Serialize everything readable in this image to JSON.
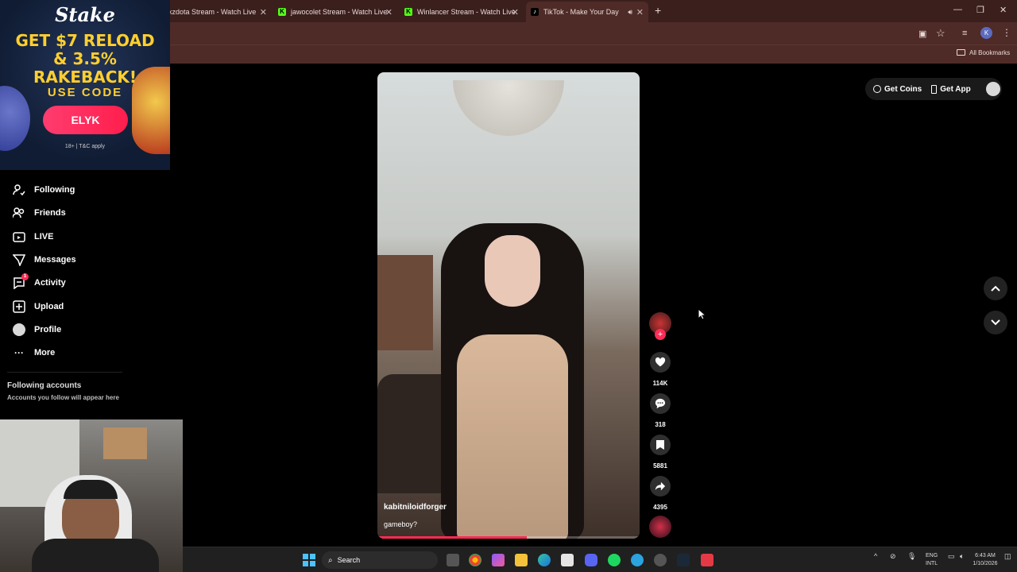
{
  "browser": {
    "tabs": [
      {
        "label": "kzdota Stream - Watch Live",
        "active": false
      },
      {
        "label": "jawocolet Stream - Watch Live",
        "active": false
      },
      {
        "label": "Winlancer Stream - Watch Live",
        "active": false
      },
      {
        "label": "TikTok - Make Your Day",
        "active": true
      }
    ],
    "new_tab": "+",
    "bookmarks_label": "All Bookmarks",
    "profile_initial": "K"
  },
  "ad": {
    "brand": "Stake",
    "headline_line1": "GET $7 RELOAD",
    "headline_line2": "& 3.5% RAKEBACK!",
    "use_code": "USE CODE",
    "code": "ELYK",
    "terms": "18+ | T&C apply"
  },
  "sidebar": {
    "items": [
      {
        "label": "Following",
        "icon": "following-icon"
      },
      {
        "label": "Friends",
        "icon": "friends-icon"
      },
      {
        "label": "LIVE",
        "icon": "live-icon"
      },
      {
        "label": "Messages",
        "icon": "messages-icon"
      },
      {
        "label": "Activity",
        "icon": "activity-icon",
        "badge": "1"
      },
      {
        "label": "Upload",
        "icon": "upload-icon"
      },
      {
        "label": "Profile",
        "icon": "profile-icon"
      },
      {
        "label": "More",
        "icon": "more-icon"
      }
    ],
    "following_accounts_title": "Following accounts",
    "following_accounts_sub": "Accounts you follow will appear here"
  },
  "topbar": {
    "get_coins": "Get Coins",
    "get_app": "Get App"
  },
  "video": {
    "author": "kabitniloidforger",
    "caption": "gameboy?",
    "progress": 0.57
  },
  "actions": {
    "likes": "114K",
    "comments": "318",
    "saves": "5881",
    "shares": "4395"
  },
  "taskbar": {
    "search_label": "Search",
    "lang_line1": "ENG",
    "lang_line2": "INTL",
    "time": "6:43 AM",
    "date": "1/10/2026"
  },
  "colors": {
    "accent": "#fe2c55",
    "chrome": "#3a1f1d",
    "ad_yellow": "#ffcf2e"
  }
}
